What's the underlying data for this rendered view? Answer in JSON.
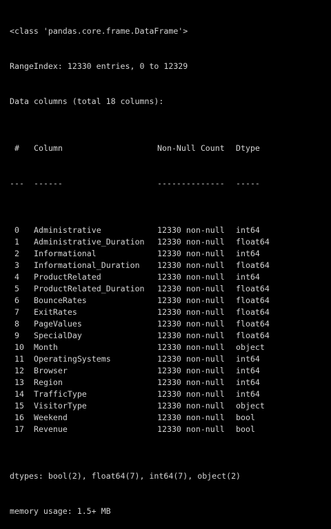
{
  "output": {
    "class_line": "<class 'pandas.core.frame.DataFrame'>",
    "range_index": "RangeIndex: 12330 entries, 0 to 12329",
    "data_columns": "Data columns (total 18 columns):",
    "header": {
      "idx": " #",
      "column": "Column",
      "count": "Non-Null Count",
      "dtype": "Dtype"
    },
    "separator": {
      "idx": "---",
      "column": "------",
      "count": "--------------",
      "dtype": "-----"
    },
    "rows": [
      {
        "idx": " 0",
        "column": "Administrative",
        "count": "12330 non-null",
        "dtype": "int64"
      },
      {
        "idx": " 1",
        "column": "Administrative_Duration",
        "count": "12330 non-null",
        "dtype": "float64"
      },
      {
        "idx": " 2",
        "column": "Informational",
        "count": "12330 non-null",
        "dtype": "int64"
      },
      {
        "idx": " 3",
        "column": "Informational_Duration",
        "count": "12330 non-null",
        "dtype": "float64"
      },
      {
        "idx": " 4",
        "column": "ProductRelated",
        "count": "12330 non-null",
        "dtype": "int64"
      },
      {
        "idx": " 5",
        "column": "ProductRelated_Duration",
        "count": "12330 non-null",
        "dtype": "float64"
      },
      {
        "idx": " 6",
        "column": "BounceRates",
        "count": "12330 non-null",
        "dtype": "float64"
      },
      {
        "idx": " 7",
        "column": "ExitRates",
        "count": "12330 non-null",
        "dtype": "float64"
      },
      {
        "idx": " 8",
        "column": "PageValues",
        "count": "12330 non-null",
        "dtype": "float64"
      },
      {
        "idx": " 9",
        "column": "SpecialDay",
        "count": "12330 non-null",
        "dtype": "float64"
      },
      {
        "idx": " 10",
        "column": "Month",
        "count": "12330 non-null",
        "dtype": "object"
      },
      {
        "idx": " 11",
        "column": "OperatingSystems",
        "count": "12330 non-null",
        "dtype": "int64"
      },
      {
        "idx": " 12",
        "column": "Browser",
        "count": "12330 non-null",
        "dtype": "int64"
      },
      {
        "idx": " 13",
        "column": "Region",
        "count": "12330 non-null",
        "dtype": "int64"
      },
      {
        "idx": " 14",
        "column": "TrafficType",
        "count": "12330 non-null",
        "dtype": "int64"
      },
      {
        "idx": " 15",
        "column": "VisitorType",
        "count": "12330 non-null",
        "dtype": "object"
      },
      {
        "idx": " 16",
        "column": "Weekend",
        "count": "12330 non-null",
        "dtype": "bool"
      },
      {
        "idx": " 17",
        "column": "Revenue",
        "count": "12330 non-null",
        "dtype": "bool"
      }
    ],
    "dtypes_line": "dtypes: bool(2), float64(7), int64(7), object(2)",
    "memory_line": "memory usage: 1.5+ MB"
  },
  "colors": {
    "background": "#000000",
    "text": "#d4d4d4"
  }
}
